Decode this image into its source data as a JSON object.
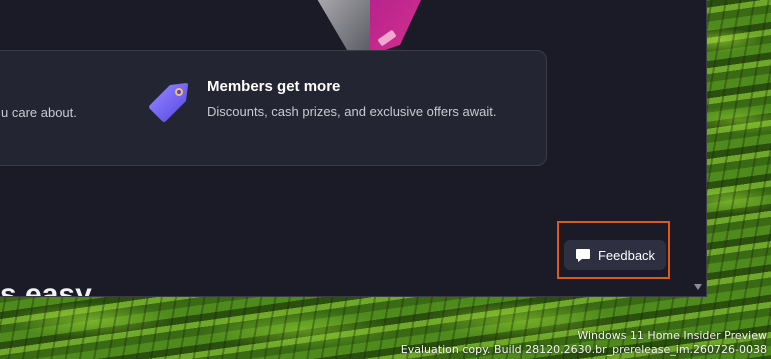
{
  "card": {
    "left_text": "u care about.",
    "feature": {
      "title": "Members get more",
      "description": "Discounts, cash prizes, and exclusive offers await."
    }
  },
  "section_heading_partial": "s easy",
  "feedback": {
    "label": "Feedback"
  },
  "watermark": {
    "line1": "Windows 11 Home Insider Preview",
    "line2": "Evaluation copy. Build 28120.2630.br_prerelease_im.260726-0038"
  },
  "colors": {
    "app_background": "#1a1b26",
    "card_background": "#242532",
    "highlight_border": "#e0591a",
    "tag_gradient_start": "#8a7bff",
    "tag_gradient_end": "#5b4df0"
  }
}
